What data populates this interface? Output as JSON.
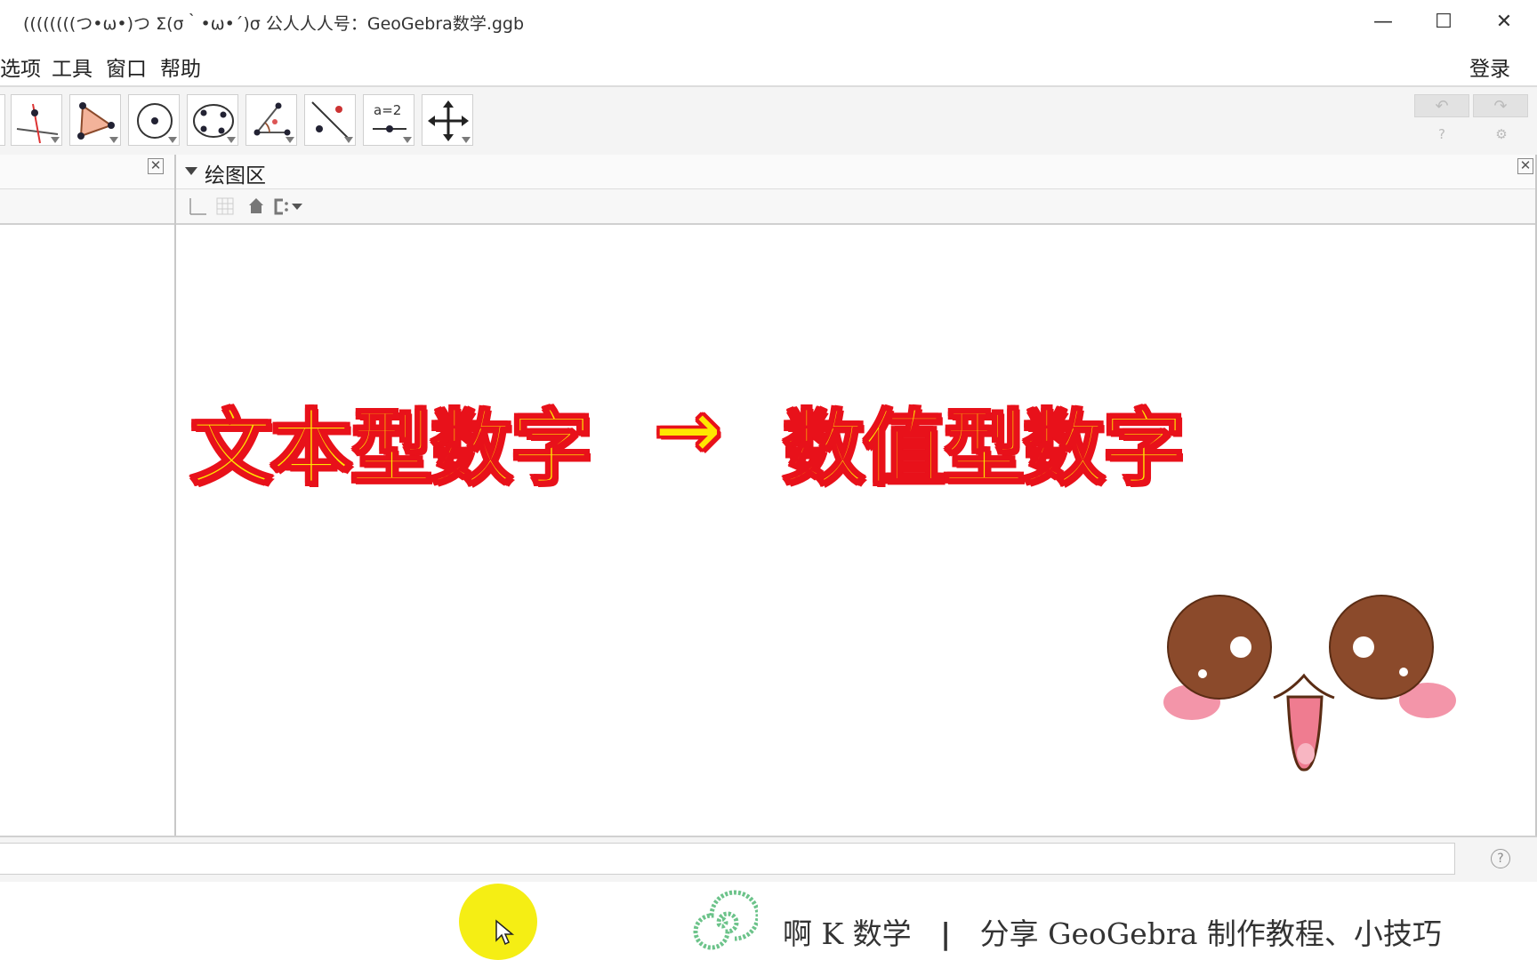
{
  "window": {
    "title": "((((((((つ•ω•)つ Σ(σ｀•ω•´)σ 公人人人号：GeoGebra数学.ggb",
    "minimize": "—",
    "maximize": "☐",
    "close": "✕"
  },
  "menu": {
    "items": [
      "选项",
      "工具",
      "窗口",
      "帮助"
    ],
    "login": "登录"
  },
  "toolbar": {
    "tools": [
      "point-on-line-tool",
      "polygon-tool",
      "circle-center-tool",
      "conic-through-points-tool",
      "angle-tool",
      "reflect-tool",
      "slider-tool",
      "move-view-tool"
    ],
    "slider_label": "a=2",
    "undo": "↶",
    "redo": "↷"
  },
  "graphics": {
    "header": "绘图区",
    "overlay_left": "文本型数字",
    "overlay_arrow": "→",
    "overlay_right": "数值型数字"
  },
  "footer": {
    "brand": "啊 K 数学",
    "separator": "|",
    "tagline": "分享 GeoGebra 制作教程、小技巧"
  },
  "colors": {
    "caption_fill": "#ffe600",
    "caption_stroke": "#e8111a",
    "cursor_highlight": "#f5ee14",
    "eye_brown": "#8b4a2b",
    "blush_pink": "#f28aa0"
  }
}
